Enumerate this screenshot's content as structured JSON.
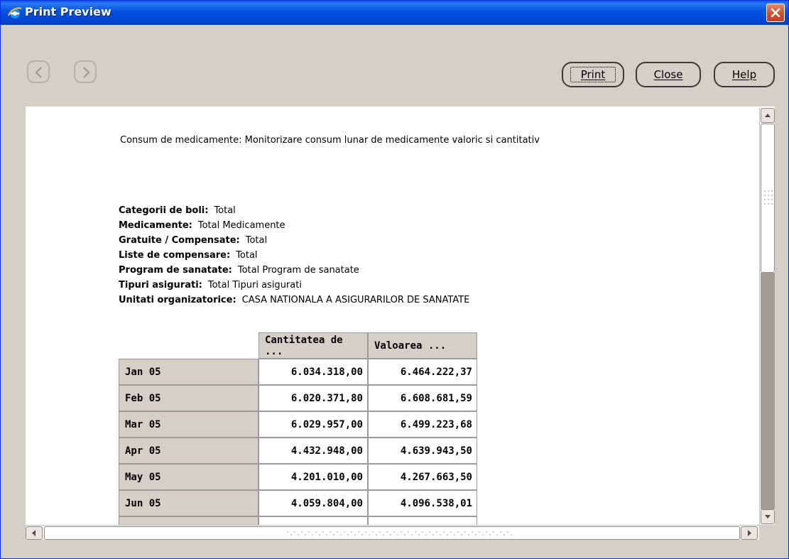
{
  "window": {
    "title": "Print Preview"
  },
  "toolbar": {
    "print_label": "Print",
    "close_label": "Close",
    "help_label": "Help"
  },
  "report": {
    "title": "Consum de medicamente: Monitorizare consum lunar de medicamente valoric si cantitativ",
    "params": [
      {
        "key": "Categorii de boli:",
        "value": "Total"
      },
      {
        "key": "Medicamente:",
        "value": "Total Medicamente"
      },
      {
        "key": "Gratuite / Compensate:",
        "value": "Total"
      },
      {
        "key": "Liste de compensare:",
        "value": "Total"
      },
      {
        "key": "Program de sanatate:",
        "value": "Total Program de sanatate"
      },
      {
        "key": "Tipuri asigurati:",
        "value": "Total Tipuri asigurati"
      },
      {
        "key": "Unitati organizatorice:",
        "value": "CASA NATIONALA A ASIGURARILOR DE SANATATE"
      }
    ],
    "table": {
      "columns": [
        "Cantitatea de ...",
        "Valoarea ..."
      ],
      "rows": [
        {
          "label": "Jan 05",
          "qty": "6.034.318,00",
          "val": "6.464.222,37"
        },
        {
          "label": "Feb 05",
          "qty": "6.020.371,80",
          "val": "6.608.681,59"
        },
        {
          "label": "Mar 05",
          "qty": "6.029.957,00",
          "val": "6.499.223,68"
        },
        {
          "label": "Apr 05",
          "qty": "4.432.948,00",
          "val": "4.639.943,50"
        },
        {
          "label": "May 05",
          "qty": "4.201.010,00",
          "val": "4.267.663,50"
        },
        {
          "label": "Jun 05",
          "qty": "4.059.804,00",
          "val": "4.096.538,01"
        }
      ]
    }
  },
  "icons": {
    "app": "ie-logo-icon",
    "close": "close-icon",
    "back": "back-arrow-icon",
    "forward": "forward-arrow-icon"
  },
  "colors": {
    "titlebar": "#0052e0",
    "close_button": "#d14f2c",
    "chrome": "#d4d0c8"
  }
}
